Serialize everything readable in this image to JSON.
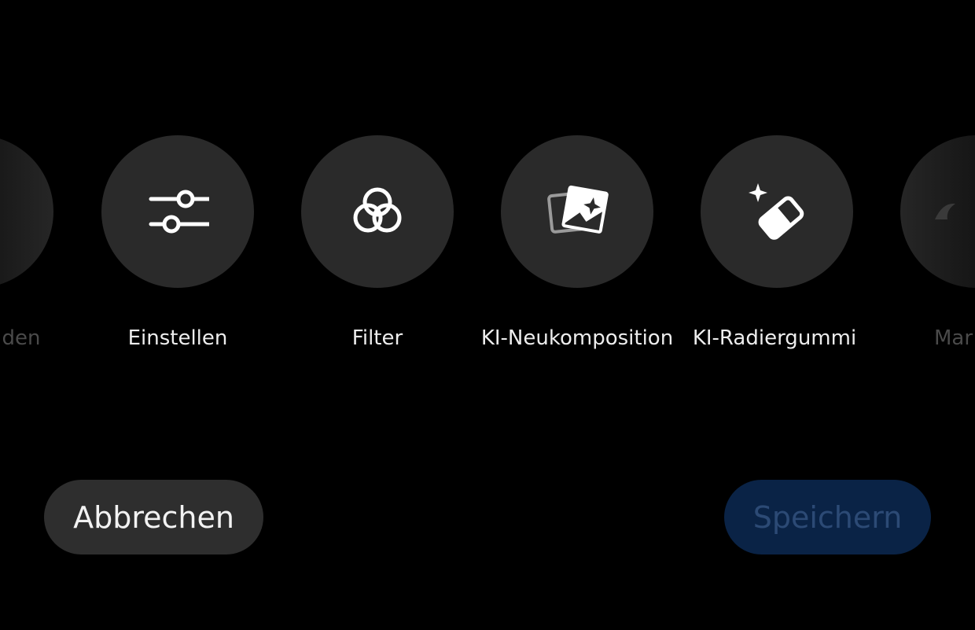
{
  "tools": [
    {
      "label": "den",
      "icon": "partial-tool-icon",
      "state": "faded"
    },
    {
      "label": "Einstellen",
      "icon": "sliders-icon"
    },
    {
      "label": "Filter",
      "icon": "filter-circles-icon"
    },
    {
      "label": "KI-Neukomposition",
      "icon": "ai-recompose-icon"
    },
    {
      "label": "KI-Radiergummi",
      "icon": "ai-eraser-icon"
    },
    {
      "label": "Mar",
      "icon": "partial-tool-icon",
      "state": "faded"
    }
  ],
  "actions": {
    "cancel_label": "Abbrechen",
    "save_label": "Speichern",
    "save_enabled": false
  },
  "colors": {
    "background": "#000000",
    "tool_circle": "#2a2a2a",
    "cancel_button": "#2e2e2e",
    "save_button_disabled": "#0a2346",
    "save_text_disabled": "#2c4a75"
  }
}
